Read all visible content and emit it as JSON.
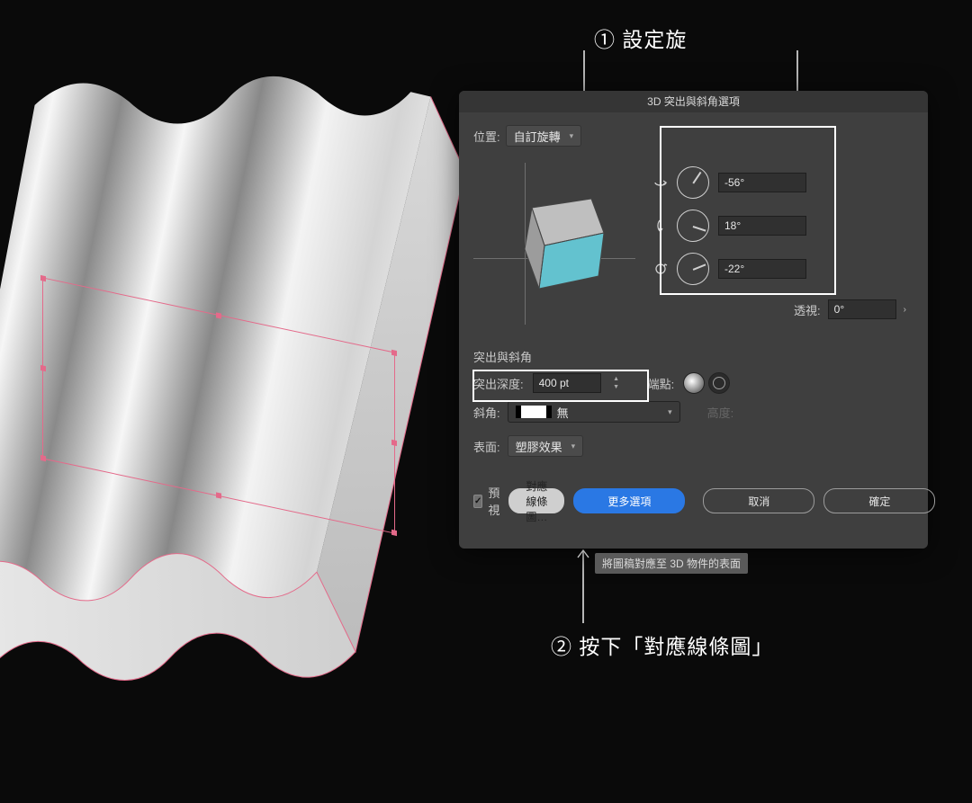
{
  "dialog": {
    "title": "3D 突出與斜角選項",
    "position_label": "位置:",
    "position_value": "自訂旋轉",
    "rotation": {
      "x": "-56°",
      "x_angle": -56,
      "y": "18°",
      "y_angle": 18,
      "z": "-22°",
      "z_angle": -22
    },
    "perspective_label": "透視:",
    "perspective_value": "0°",
    "section_extrude": "突出與斜角",
    "depth_label": "突出深度:",
    "depth_value": "400 pt",
    "cap_label": "端點:",
    "bevel_label": "斜角:",
    "bevel_value": "無",
    "height_label": "高度:",
    "surface_label": "表面:",
    "surface_value": "塑膠效果",
    "preview_label": "預視",
    "btn_map": "對應線條圖…",
    "btn_more": "更多選項",
    "btn_cancel": "取消",
    "btn_ok": "確定"
  },
  "tooltip": "將圖稿對應至 3D 物件的表面",
  "annotation": {
    "one": "① 設定旋",
    "two": "② 按下「對應線條圖」"
  }
}
